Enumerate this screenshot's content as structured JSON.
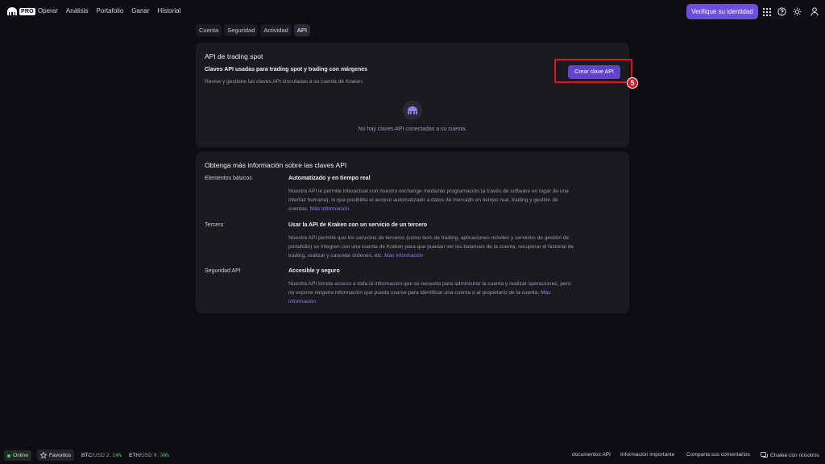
{
  "header": {
    "logo_badge": "PRO",
    "nav": [
      "Operar",
      "Análisis",
      "Portafolio",
      "Ganar",
      "Historial"
    ],
    "verify_button": "Verifique su identidad",
    "icons": [
      "grid-icon",
      "help-icon",
      "theme-sun-icon",
      "user-icon"
    ]
  },
  "tabs": [
    {
      "label": "Cuenta",
      "active": false
    },
    {
      "label": "Seguridad",
      "active": false
    },
    {
      "label": "Actividad",
      "active": false
    },
    {
      "label": "API",
      "active": true
    }
  ],
  "api_card": {
    "title": "API de trading spot",
    "subtitle": "Claves API usadas para trading spot y trading con márgenes",
    "description": "Revise y gestione las claves API vinculadas a su cuenta de Kraken.",
    "create_button": "Crear clave API",
    "step_number": "5",
    "empty_state": "No hay claves API conectadas a su cuenta."
  },
  "info_card": {
    "title": "Obtenga más información sobre las claves API",
    "link_text": "Más información",
    "rows": [
      {
        "label": "Elementos básicos",
        "heading": "Automatizado y en tiempo real",
        "body_lines": [
          "Nuestra API le permite interactuar con nuestro exchange mediante programación (a través de software en lugar de una",
          "interfaz humana), lo que posibilita el acceso automatizado a datos de mercado en tiempo real, trading y gestión de",
          "cuentas."
        ]
      },
      {
        "label": "Tercero",
        "heading": "Usar la API de Kraken con un servicio de un tercero",
        "body_lines": [
          "Nuestra API permite que los servicios de terceros (como bots de trading, aplicaciones móviles y servicios de gestión de",
          "portafolio) se integren con una cuenta de Kraken para que puedan ver los balances de la cuenta, recuperar el historial de",
          "trading, realizar y cancelar órdenes, etc."
        ]
      },
      {
        "label": "Seguridad API",
        "heading": "Accesible y seguro",
        "body_lines": [
          "Nuestra API brinda acceso a toda la información que se necesita para administrar la cuenta y realizar operaciones, pero",
          "no expone ninguna información que pueda usarse para identificar una cuenta o al propietario de la cuenta.",
          ""
        ],
        "link_line_2": "Más",
        "link_line_3": "información"
      }
    ]
  },
  "footer": {
    "status": "Online",
    "favorites": "Favoritos",
    "tickers": [
      {
        "base": "BTC",
        "quote": "/USD",
        "change": "2.14%"
      },
      {
        "base": "ETH",
        "quote": "/USD",
        "change": "9.38%"
      }
    ],
    "links": [
      "documentos API",
      "Información importante",
      "Comparta sus comentarios",
      "Chatee con nosotros"
    ],
    "colors": {
      "positive": "#3ecf7c",
      "accent": "#6d4fe0",
      "highlight": "#e3131d"
    }
  }
}
